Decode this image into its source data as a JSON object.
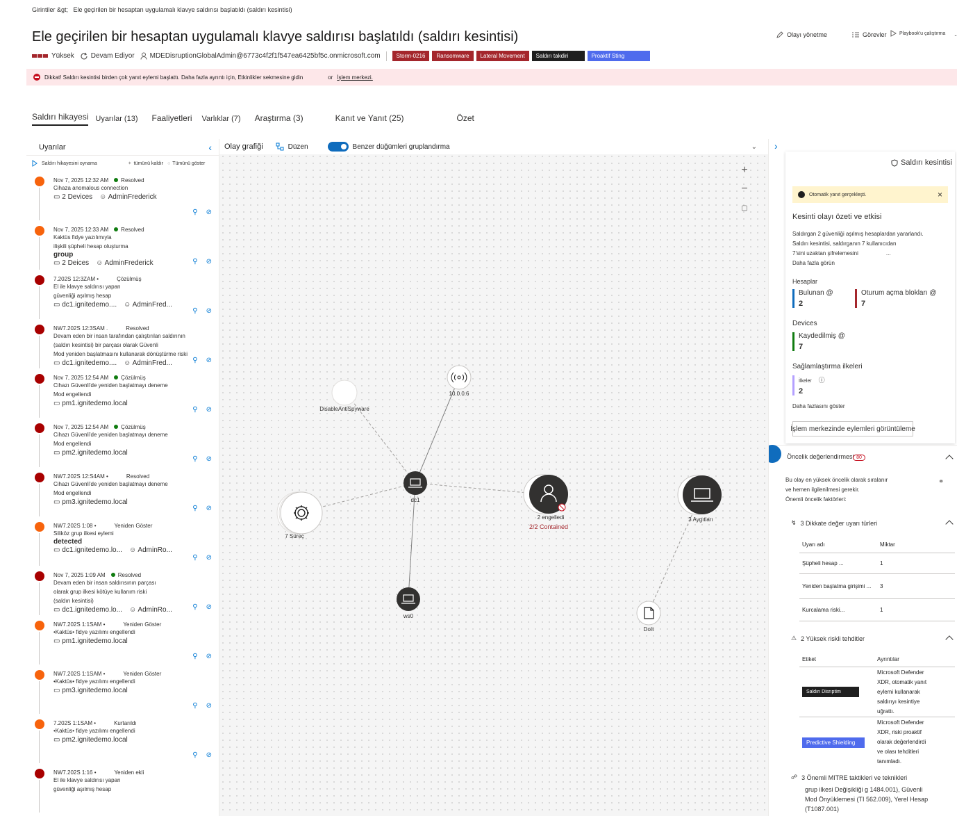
{
  "breadcrumb": {
    "root": "Girintiler &gt;",
    "current": "Ele geçirilen bir hesaptan uygulamalı klavye saldırısı başlatıldı (saldırı kesintisi)"
  },
  "title": "Ele geçirilen bir hesaptan uygulamalı klavye saldırısı başlatıldı (saldırı kesintisi)",
  "actions": {
    "manage": "Olayı yönetme",
    "tasks": "Görevler",
    "playbook": "Playbook'u çalıştırma",
    "more": "..."
  },
  "meta": {
    "severity": "Yüksek",
    "status": "Devam Ediyor",
    "owner": "MDEDisruptionGlobalAdmin@6773c4f2f1f547ea6425bf5c.onmicrosoft.com",
    "tags": [
      {
        "label": "Storm-0216",
        "color": "#a4262c"
      },
      {
        "label": "Ransomware",
        "color": "#a4262c"
      },
      {
        "label": "Lateral Movement",
        "color": "#a4262c"
      },
      {
        "label": "Saldırı takdiri",
        "color": "#1f1f1f"
      },
      {
        "label": "Proaktif Sting",
        "color": "#4f6bed"
      }
    ]
  },
  "banner": {
    "text": "Dikkat! Saldırı kesintisi birden çok yanıt eylemi başlattı.  Daha fazla ayrıntı için, Etkinlikler sekmesine gidin",
    "or": "or",
    "link": "İşlem merkezi."
  },
  "tabs": [
    {
      "label": "Saldırı hikayesi",
      "active": true
    },
    {
      "label": "Uyarılar (13)"
    },
    {
      "label": "Faaliyetleri"
    },
    {
      "label": "Varlıklar (7)"
    },
    {
      "label": "Araştırma (3)"
    },
    {
      "label": "Kanıt ve Yanıt (25)"
    },
    {
      "label": "Özet"
    }
  ],
  "alerts_panel": {
    "title": "Uyarılar",
    "play": "Saldırı hikayesini oynama",
    "unpin": "tümünü kaldır",
    "showall": "Tümünü göster",
    "items": [
      {
        "color": "#f7630c",
        "time": "Nov 7, 2025 12:32 AM",
        "status": "Resolved",
        "dot": true,
        "t1": "Cihaza anomalous connection",
        "t2": "",
        "big": "",
        "dev": "2 Devices",
        "user": "AdminFrederick"
      },
      {
        "color": "#f7630c",
        "time": "Nov 7, 2025 12:33 AM",
        "status": "Resolved",
        "dot": true,
        "t1": "Kaktüs fidye yazılımıyla",
        "t2": "ilişkili şüpheli hesap oluşturma",
        "big": "group",
        "dev": "2 Deices",
        "user": "AdminFrederick"
      },
      {
        "color": "#a80000",
        "time": "7.202S 12:3ZAM •",
        "status": "Çözülmüş",
        "dot": false,
        "t1": "El ile klavye saldırısı yapan",
        "t2": "güvenliği aşılmış hesap",
        "big": "",
        "dev": "dc1.ignitedemo....",
        "user": "AdminFred..."
      },
      {
        "color": "#a80000",
        "time": "NW7.202S 12:3SAM .",
        "status": "Resolved",
        "dot": false,
        "t1": "Devam eden bir insan tarafından çalıştırılan saldırının",
        "t2": "(saldırı kesintisi) bir parçası olarak Güvenli",
        "t3": "Mod yeniden başlatmasını kullanarak dönüştürme riski",
        "big": "",
        "dev": "dc1.ignitedemo....",
        "user": "AdminFred..."
      },
      {
        "color": "#a80000",
        "time": "Nov 7, 2025 12:54 AM",
        "status": "Çözülmüş",
        "dot": true,
        "t1": "Cihazı Güvenli'de yeniden başlatmayı deneme",
        "t2": "Mod engellendi",
        "big": "",
        "dev": "pm1.ignitedemo.local",
        "user": ""
      },
      {
        "color": "#a80000",
        "time": "Nov 7, 2025 12:54 AM",
        "status": "Çözülmüş",
        "dot": true,
        "t1": "Cihazı Güvenli'de yeniden başlatmayı deneme",
        "t2": "Mod engellendi",
        "big": "",
        "dev": "pm2.ignitedemo.local",
        "user": ""
      },
      {
        "color": "#a80000",
        "time": "NW7.202S 12:S4AM •",
        "status": "Resolved",
        "dot": false,
        "t1": "Cihazı Güvenli'de yeniden başlatmayı deneme",
        "t2": "Mod engellendi",
        "big": "",
        "dev": "pm3.ignitedemo.local",
        "user": ""
      },
      {
        "color": "#f7630c",
        "time": "NW7.202S 1:08 •",
        "status": "Yeniden Göster",
        "dot": false,
        "t1": "Siliköz grup ilkesi eylemi",
        "t2": "",
        "big": "detected",
        "dev": "dc1.ignitedemo.lo...",
        "user": "AdminRo..."
      },
      {
        "color": "#a80000",
        "time": "Nov 7, 2025 1:09 AM",
        "status": "Resolved",
        "dot": true,
        "t1": "Devam eden bir insan saldırısının parçası",
        "t2": "olarak grup ilkesi kötüye kullanım riski",
        "t3": "(saldırı kesintisi)",
        "big": "",
        "dev": "dc1.ignitedemo.lo...",
        "user": "AdminRo..."
      },
      {
        "color": "#f7630c",
        "time": "NW7.202S 1:1SAM •",
        "status": "Yeniden Göster",
        "dot": false,
        "t1": "•Kaktüs• fidye yazılımı engellendi",
        "t2": "",
        "big": "",
        "dev": "pm1.ignitedemo.local",
        "user": ""
      },
      {
        "color": "#f7630c",
        "time": "NW7.202S 1:1SAM •",
        "status": "Yeniden Göster",
        "dot": false,
        "t1": "•Kaktüs• fidye yazılımı engellendi",
        "t2": "",
        "big": "",
        "dev": "pm3.ignitedemo.local",
        "user": ""
      },
      {
        "color": "#f7630c",
        "time": "7.202S 1:1SAM •",
        "status": "Kurtarıldı",
        "dot": false,
        "t1": "•Kaktüs• fidye yazılımı engellendi",
        "t2": "",
        "big": "",
        "dev": "pm2.ignitedemo.local",
        "user": ""
      },
      {
        "color": "#a80000",
        "time": "NW7.202S 1:16 •",
        "status": "Yeniden ekli",
        "dot": false,
        "t1": "El ile klavye saldırısı yapan",
        "t2": "güvenliği aşılmış hesap",
        "big": "",
        "dev": "",
        "user": ""
      }
    ]
  },
  "graph": {
    "title": "Olay grafiği",
    "layout": "Düzen",
    "group": "Benzer düğümleri gruplandırma",
    "nodes": {
      "antispy": "DisableAntiSpyware",
      "ip": "10.0.0.6",
      "dc1": "dc1",
      "proc": "7 Süreç",
      "blocked": "2 engelledi",
      "contained": "2/2 Contained",
      "devices": "3 Aygıtları",
      "ws0": "ws0",
      "doit": "DoIt"
    }
  },
  "right_panel": {
    "card_title": "Saldırı kesintisi",
    "warn": "Otomatik yanıt gerçekleşti.",
    "summary_title": "Kesinti olayı özeti ve etkisi",
    "summary": [
      "Saldırgan 2 güvenliği aşılmış hesaplardan yararlandı.",
      "Saldırı kesintisi, saldırganın 7 kullanıcıdan",
      "7'sini uzaktan şifrelemesini",
      "Daha fazla görün"
    ],
    "ellipsis": "...",
    "accounts": "Hesaplar",
    "found": "Bulunan @",
    "found_val": "2",
    "blocked": "Oturum açma blokları @",
    "blocked_val": "7",
    "devices": "Devices",
    "registered": "Kaydedilmiş @",
    "registered_val": "7",
    "policies": "Sağlamlaştırma ilkeleri",
    "policies_lbl": "İlkeler",
    "policies_val": "2",
    "more": "Daha fazlasını göster",
    "action_btn": "İşlem merkezinde eylemleri görüntüleme",
    "priority": "Öncelik değerlendirmesi",
    "priority_score": "80",
    "priority_text": [
      "Bu olay en yüksek öncelik olarak sıralanır",
      "ve hemen ilgilenilmesi gerekir.",
      "Önemli öncelik faktörleri:"
    ],
    "alert_types": "3 Dikkate değer uyarı türleri",
    "col_name": "Uyarı adı",
    "col_qty": "Miktar",
    "rows": [
      {
        "name": "Şüpheli hesap ...",
        "qty": "1"
      },
      {
        "name": "Yeniden başlatma girişimi ...",
        "qty": "3"
      },
      {
        "name": "Kurcalama riski...",
        "qty": "1"
      }
    ],
    "threats": "2 Yüksek riskli tehditler",
    "col_label": "Etiket",
    "col_details": "Ayrıntılar",
    "threat_rows": [
      {
        "label": "Saldırı Disrıptim",
        "color": "#1f1f1f",
        "details": [
          "Microsoft Defender",
          "XDR, otomatik yanıt",
          "eylemi kullanarak",
          "saldırıyı kesintiye",
          "uğrattı."
        ]
      },
      {
        "label": "Predictive Shielding",
        "color": "#4f6bed",
        "details": [
          "Microsoft Defender",
          "XDR, riski proaktif",
          "olarak değerlendirdi",
          "ve olası tehditleri",
          "tanımladı."
        ]
      }
    ],
    "mitre": "3 Önemli MITRE taktikleri ve teknikleri",
    "mitre_text": [
      "grup ilkesi Değişikliği g 1484.001), Güvenli",
      "Mod Önyüklemesi (TI 562.009), Yerel Hesap",
      "(T1087.001)"
    ]
  }
}
